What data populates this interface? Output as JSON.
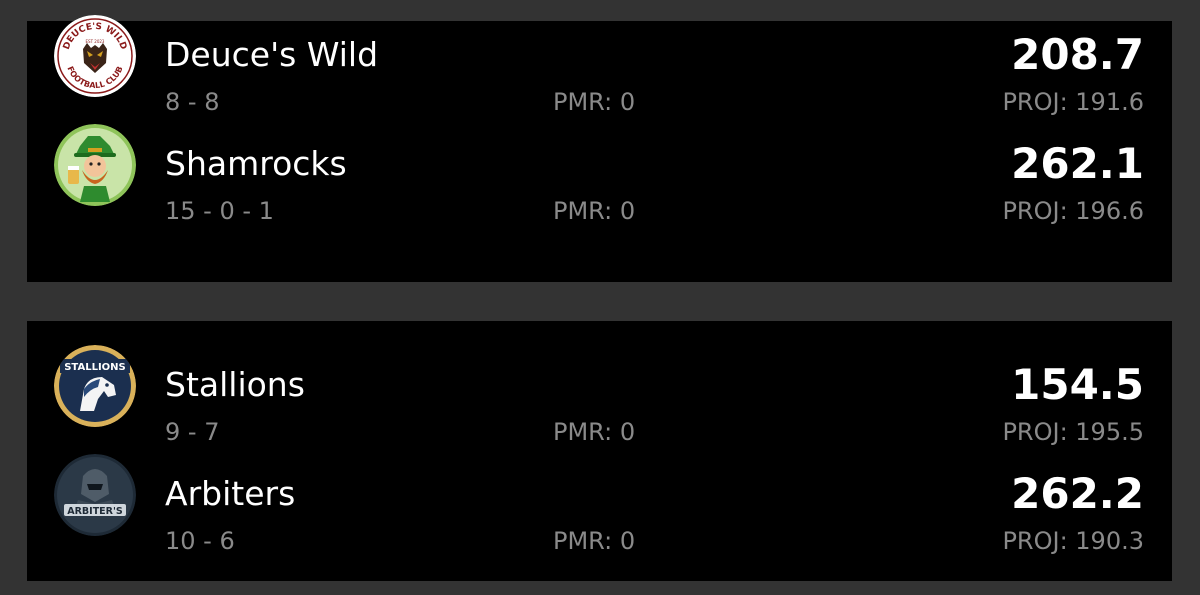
{
  "matchups": [
    {
      "teams": [
        {
          "name": "Deuce's Wild",
          "record": "8 - 8",
          "pmr": "PMR: 0",
          "score": "208.7",
          "proj": "PROJ: 191.6",
          "logo_text_top": "DEUCE'S WILD",
          "logo_text_bottom": "FOOTBALL CLUB",
          "logo_tag": "EST 2023"
        },
        {
          "name": "Shamrocks",
          "record": "15 - 0 - 1",
          "pmr": "PMR: 0",
          "score": "262.1",
          "proj": "PROJ: 196.6"
        }
      ]
    },
    {
      "teams": [
        {
          "name": "Stallions",
          "record": "9 - 7",
          "pmr": "PMR: 0",
          "score": "154.5",
          "proj": "PROJ: 195.5",
          "logo_text": "STALLIONS"
        },
        {
          "name": "Arbiters",
          "record": "10 - 6",
          "pmr": "PMR: 0",
          "score": "262.2",
          "proj": "PROJ: 190.3",
          "logo_text": "ARBITER'S"
        }
      ]
    }
  ],
  "colors": {
    "page_bg": "#333333",
    "card_bg": "#000000",
    "primary_text": "#ffffff",
    "secondary_text": "#8a8a8a"
  }
}
